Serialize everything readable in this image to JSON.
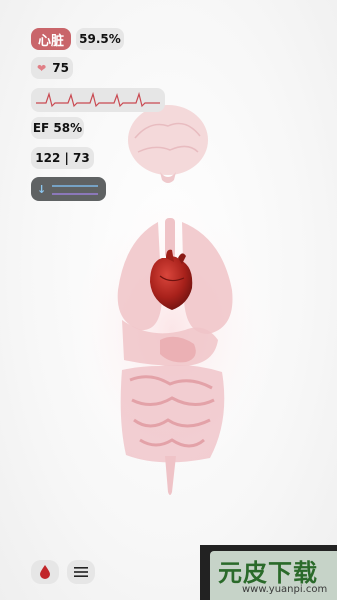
{
  "stats": {
    "organ_label": "心脏",
    "percent": "59.5%",
    "heart_rate": "75",
    "ef": "EF 58%",
    "blood_pressure": "122 | 73"
  },
  "icons": {
    "heart": "heart-icon",
    "flow_arrow": "down-arrow-icon",
    "blood_drop": "blood-drop-icon",
    "menu": "menu-icon"
  },
  "colors": {
    "organ_badge": "#c9656a",
    "ecg_line": "#c94a52",
    "flow_line_1": "#7fb8e6",
    "flow_line_2": "#9a7fd6",
    "heart": "#b3221c"
  },
  "watermark": {
    "brand": "元皮下载",
    "url": "www.yuanpi.com"
  }
}
